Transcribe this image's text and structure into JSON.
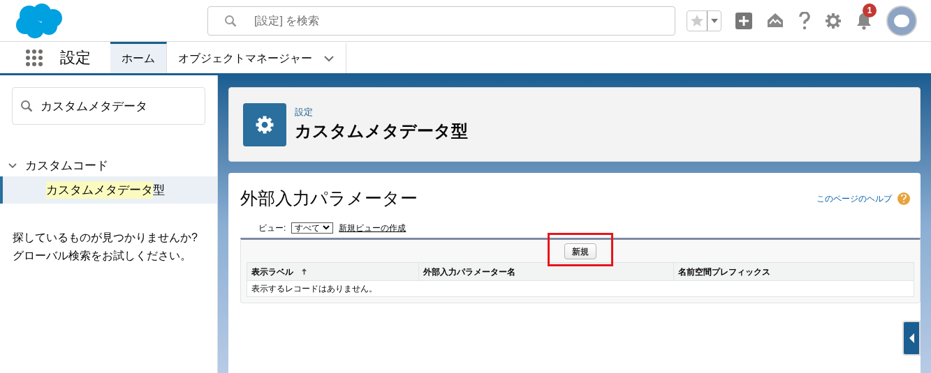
{
  "header": {
    "search": {
      "placeholder": "[設定] を検索"
    },
    "notifications": {
      "count": "1"
    }
  },
  "nav": {
    "app_name": "設定",
    "tabs": [
      {
        "label": "ホーム",
        "selected": true,
        "menu": false
      },
      {
        "label": "オブジェクトマネージャー",
        "selected": false,
        "menu": true
      }
    ]
  },
  "sidebar": {
    "search": {
      "value": "カスタムメタデータ"
    },
    "tree": [
      {
        "label": "カスタムコード",
        "expanded": true,
        "children": [
          {
            "match": "カスタムメタデータ",
            "rest": "型",
            "selected": true
          }
        ]
      }
    ],
    "hint": [
      "探しているものが見つかりませんか?",
      "グローバル検索をお試しください。"
    ]
  },
  "page_header": {
    "breadcrumb": "設定",
    "title": "カスタムメタデータ型"
  },
  "content": {
    "title": "外部入力パラメーター",
    "help_link": "このページのヘルプ",
    "view_label": "ビュー:",
    "view_value": "すべて",
    "new_view_link": "新規ビューの作成",
    "new_button": {
      "label": "新規",
      "annotated": true
    },
    "table": {
      "columns": [
        {
          "label": "表示ラベル",
          "sorted": true
        },
        {
          "label": "外部入力パラメーター名",
          "sorted": false
        },
        {
          "label": "名前空間プレフィックス",
          "sorted": false
        }
      ],
      "empty_message": "表示するレコードはありません。"
    }
  }
}
